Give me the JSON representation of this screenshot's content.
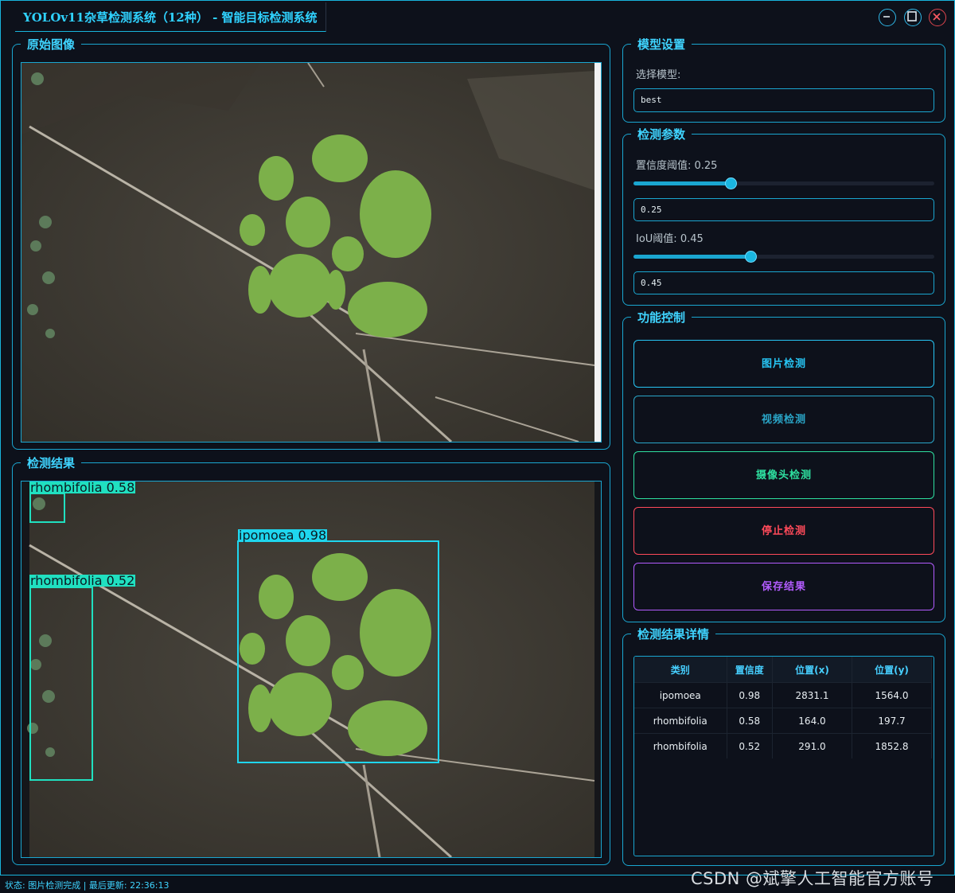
{
  "window": {
    "title": "YOLOv11杂草检测系统（12种） - 智能目标检测系统",
    "controls": [
      "minimize-icon",
      "maximize-icon",
      "close-icon"
    ]
  },
  "original_panel": {
    "title": "原始图像"
  },
  "result_panel": {
    "title": "检测结果"
  },
  "model_panel": {
    "title": "模型设置",
    "select_label": "选择模型:",
    "model_value": "best"
  },
  "params_panel": {
    "title": "检测参数",
    "confidence_label": "置信度阈值: 0.25",
    "confidence_value": "0.25",
    "confidence_level": 0.25,
    "iou_label": "IoU阈值: 0.45",
    "iou_value": "0.45",
    "iou_level": 0.45
  },
  "control_panel": {
    "title": "功能控制",
    "buttons": [
      {
        "label": "图片检测",
        "color": "#27c6f5"
      },
      {
        "label": "视频检测",
        "color": "#2aa6c8"
      },
      {
        "label": "摄像头检测",
        "color": "#2ee0a0"
      },
      {
        "label": "停止检测",
        "color": "#ff4a5a"
      },
      {
        "label": "保存结果",
        "color": "#b35cff"
      }
    ]
  },
  "details_panel": {
    "title": "检测结果详情",
    "columns": [
      "类别",
      "置信度",
      "位置(x)",
      "位置(y)"
    ],
    "rows": [
      [
        "ipomoea",
        "0.98",
        "2831.1",
        "1564.0"
      ],
      [
        "rhombifolia",
        "0.58",
        "164.0",
        "197.7"
      ],
      [
        "rhombifolia",
        "0.52",
        "291.0",
        "1852.8"
      ]
    ]
  },
  "detections": [
    {
      "label": "ipomoea  0.98",
      "color": "#1fd6ee"
    },
    {
      "label": "rhombifolia  0.58",
      "color": "#20e0c0"
    },
    {
      "label": "rhombifolia  0.52",
      "color": "#20e0c0"
    }
  ],
  "status": {
    "text": "状态: 图片检测完成 | 最后更新: 22:36:13"
  },
  "watermark": "CSDN @斌擎人工智能官方账号"
}
